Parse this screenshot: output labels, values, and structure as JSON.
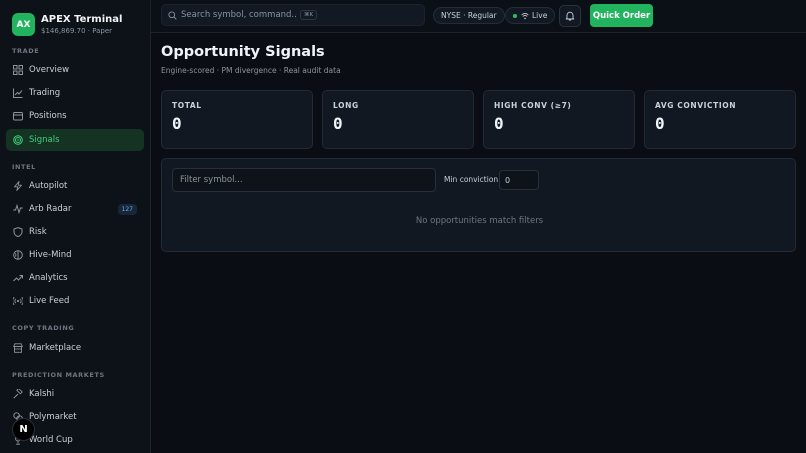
{
  "brand": {
    "logo": "AX",
    "title": "APEX Terminal",
    "subtitle": "$146,869.70 · Paper",
    "brand_color": "#22b35e"
  },
  "sidebar": {
    "sections": {
      "trade": "TRADE",
      "intel": "INTEL",
      "copy": "COPY TRADING",
      "prediction": "PREDICTION MARKETS"
    },
    "items": [
      {
        "label": "Overview",
        "icon": "grid-icon"
      },
      {
        "label": "Trading",
        "icon": "chart-line-icon"
      },
      {
        "label": "Positions",
        "icon": "wallet-icon"
      },
      {
        "label": "Signals",
        "icon": "target-icon",
        "active": true
      },
      {
        "label": "Autopilot",
        "icon": "bolt-icon"
      },
      {
        "label": "Arb Radar",
        "icon": "activity-icon",
        "badge": "127"
      },
      {
        "label": "Risk",
        "icon": "shield-icon"
      },
      {
        "label": "Hive-Mind",
        "icon": "brain-icon"
      },
      {
        "label": "Analytics",
        "icon": "trending-up-icon"
      },
      {
        "label": "Live Feed",
        "icon": "radio-icon"
      },
      {
        "label": "Marketplace",
        "icon": "store-icon"
      },
      {
        "label": "Kalshi",
        "icon": "gavel-icon"
      },
      {
        "label": "Polymarket",
        "icon": "coins-icon"
      },
      {
        "label": "World Cup",
        "icon": "trophy-icon"
      }
    ],
    "footer_logo": "N"
  },
  "topbar": {
    "search_placeholder": "Search symbol, command...",
    "search_shortcut": "⌘K",
    "market_status": "NYSE · Regular",
    "connection_status": "Live",
    "quick_order_label": "Quick Order"
  },
  "page": {
    "title": "Opportunity Signals",
    "subtitle": "Engine-scored · PM divergence · Real audit data"
  },
  "stats": [
    {
      "label": "TOTAL",
      "value": "0"
    },
    {
      "label": "LONG",
      "value": "0"
    },
    {
      "label": "HIGH CONV (≥7)",
      "value": "0"
    },
    {
      "label": "AVG CONVICTION",
      "value": "0"
    }
  ],
  "filters": {
    "symbol_placeholder": "Filter symbol...",
    "min_conviction_label": "Min conviction",
    "min_conviction_value": "0"
  },
  "empty_message": "No opportunities match filters"
}
